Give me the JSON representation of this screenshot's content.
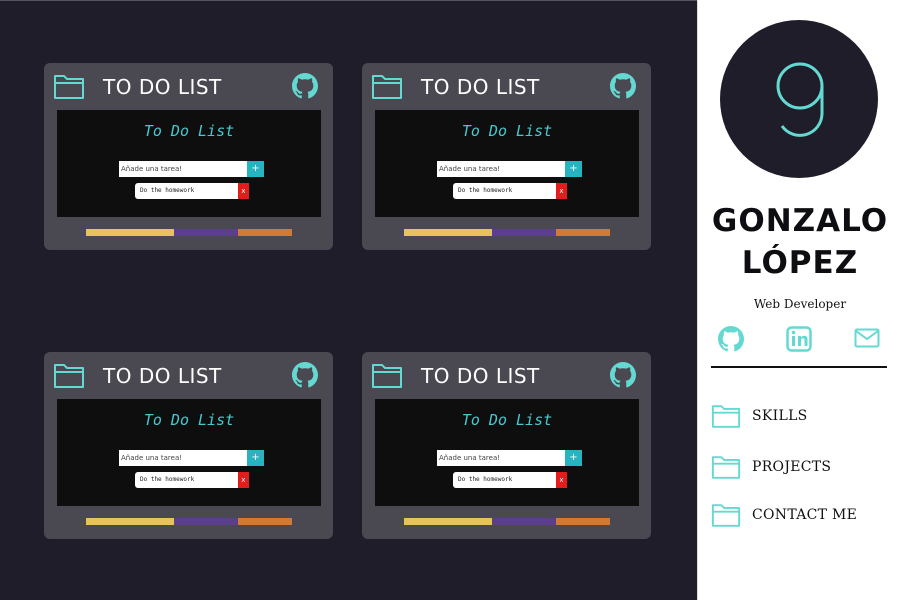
{
  "colors": {
    "background": "#1e1d29",
    "card": "#4a4850",
    "accent": "#63d9d1",
    "screen": "#0e0e0e",
    "bar_yellow": "#e8c25c",
    "bar_purple": "#5b3f8c",
    "bar_orange": "#d27a33",
    "delete": "#e31c1c",
    "add": "#27b3bf"
  },
  "projects": [
    {
      "title": "TO DO LIST",
      "screen_title": "To Do List",
      "input_placeholder": "Añade una tarea!",
      "add_label": "+",
      "task": "Do the homework",
      "delete_label": "x",
      "folder_icon": "folder-icon",
      "repo_icon": "github-icon"
    },
    {
      "title": "TO DO LIST",
      "screen_title": "To Do List",
      "input_placeholder": "Añade una tarea!",
      "add_label": "+",
      "task": "Do the homework",
      "delete_label": "x",
      "folder_icon": "folder-icon",
      "repo_icon": "github-icon"
    },
    {
      "title": "TO DO LIST",
      "screen_title": "To Do List",
      "input_placeholder": "Añade una tarea!",
      "add_label": "+",
      "task": "Do the homework",
      "delete_label": "x",
      "folder_icon": "folder-icon",
      "repo_icon": "github-icon"
    },
    {
      "title": "TO DO LIST",
      "screen_title": "To Do List",
      "input_placeholder": "Añade una tarea!",
      "add_label": "+",
      "task": "Do the homework",
      "delete_label": "x",
      "folder_icon": "folder-icon",
      "repo_icon": "github-icon"
    }
  ],
  "sidebar": {
    "logo_icon": "g-logo-icon",
    "first_name": "GONZALO",
    "last_name": "LÓPEZ",
    "role": "Web Developer",
    "social": [
      "github-icon",
      "linkedin-icon",
      "mail-icon"
    ],
    "nav": [
      {
        "label": "SKILLS",
        "icon": "folder-icon"
      },
      {
        "label": "PROJECTS",
        "icon": "folder-icon"
      },
      {
        "label": "CONTACT ME",
        "icon": "folder-icon"
      }
    ]
  }
}
